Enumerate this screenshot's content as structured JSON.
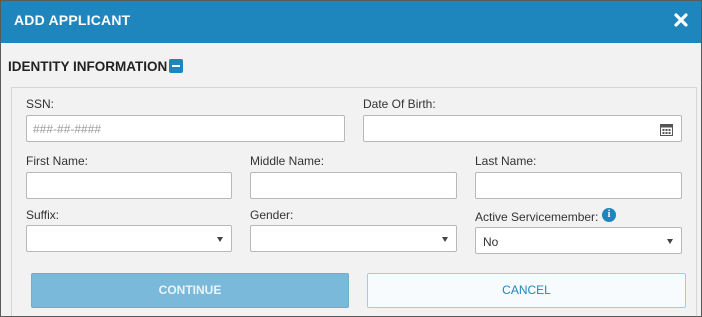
{
  "dialog": {
    "title": "ADD APPLICANT",
    "close_icon": "close-x-icon"
  },
  "section": {
    "title": "IDENTITY INFORMATION",
    "toggle_icon": "collapse-minus-icon"
  },
  "fields": {
    "ssn": {
      "label": "SSN:",
      "placeholder": "###-##-####",
      "value": ""
    },
    "dob": {
      "label": "Date Of Birth:",
      "value": "",
      "icon": "calendar-icon"
    },
    "first_name": {
      "label": "First Name:",
      "value": ""
    },
    "middle_name": {
      "label": "Middle Name:",
      "value": ""
    },
    "last_name": {
      "label": "Last Name:",
      "value": ""
    },
    "suffix": {
      "label": "Suffix:",
      "value": ""
    },
    "gender": {
      "label": "Gender:",
      "value": ""
    },
    "active_servicemember": {
      "label": "Active Servicemember:",
      "value": "No",
      "info_icon": "info-icon"
    }
  },
  "buttons": {
    "continue": "CONTINUE",
    "cancel": "CANCEL"
  },
  "colors": {
    "primary": "#1f86bd",
    "continue_bg": "#7ab9d9",
    "panel_bg": "#f2f2f2"
  }
}
